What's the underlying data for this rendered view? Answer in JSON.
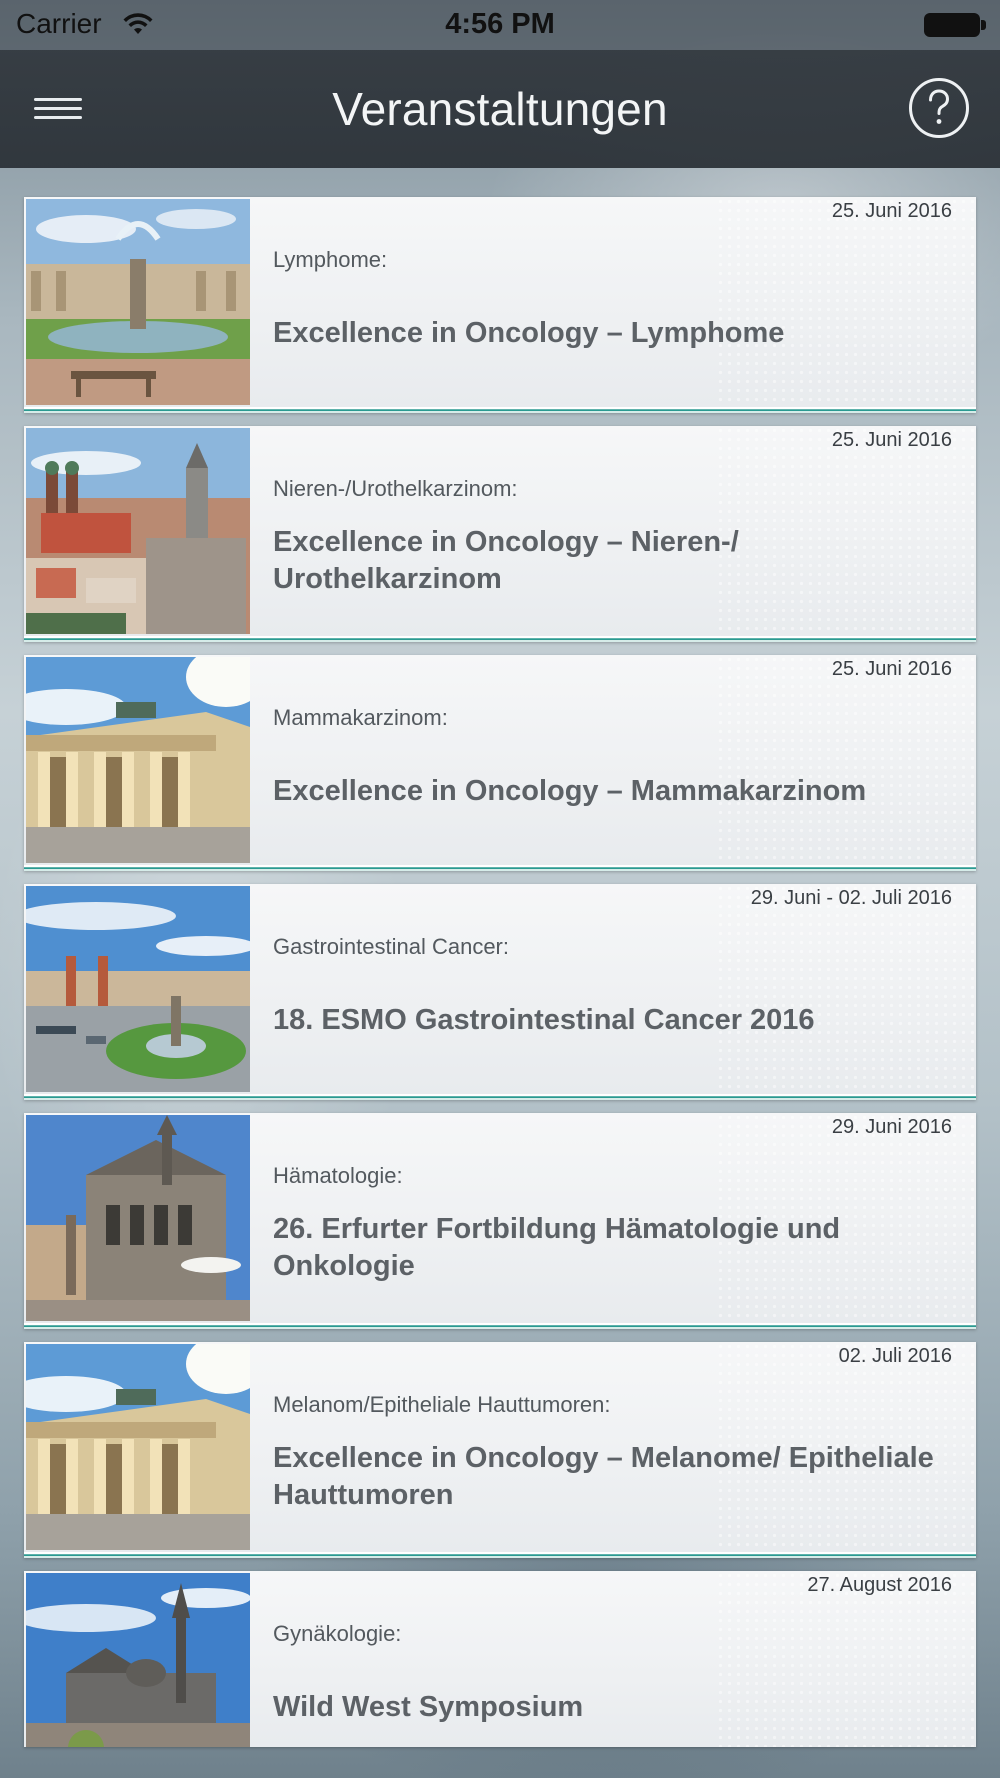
{
  "status_bar": {
    "carrier": "Carrier",
    "time": "4:56 PM"
  },
  "nav": {
    "title": "Veranstaltungen"
  },
  "events": [
    {
      "date": "25. Juni 2016",
      "category": "Lymphome:",
      "title": "Excellence in Oncology – Lymphome",
      "image": "fountain-palace"
    },
    {
      "date": "25. Juni 2016",
      "category": "Nieren-/Urothelkarzinom:",
      "title": "Excellence in Oncology – Nieren-/ Urothelkarzinom",
      "image": "munich-cityscape"
    },
    {
      "date": "25. Juni 2016",
      "category": "Mammakarzinom:",
      "title": "Excellence in Oncology – Mammakarzinom",
      "image": "brandenburg-gate"
    },
    {
      "date": "29. Juni - 02. Juli 2016",
      "category": "Gastrointestinal Cancer:",
      "title": "18. ESMO Gastrointestinal Cancer 2016",
      "image": "barcelona-plaza"
    },
    {
      "date": "29. Juni 2016",
      "category": "Hämatologie:",
      "title": "26. Erfurter Fortbildung Hämatologie und Onkologie",
      "image": "erfurt-town-hall"
    },
    {
      "date": "02. Juli 2016",
      "category": "Melanom/Epitheliale Hauttumoren:",
      "title": "Excellence in Oncology – Melanome/ Epitheliale Hauttumoren",
      "image": "brandenburg-gate"
    },
    {
      "date": "27. August 2016",
      "category": "Gynäkologie:",
      "title": "Wild West Symposium",
      "image": "aachen-cathedral"
    }
  ],
  "colors": {
    "accent_teal": "#2a9a91",
    "nav_bg": "#30363c",
    "title_text": "#5c6166"
  }
}
